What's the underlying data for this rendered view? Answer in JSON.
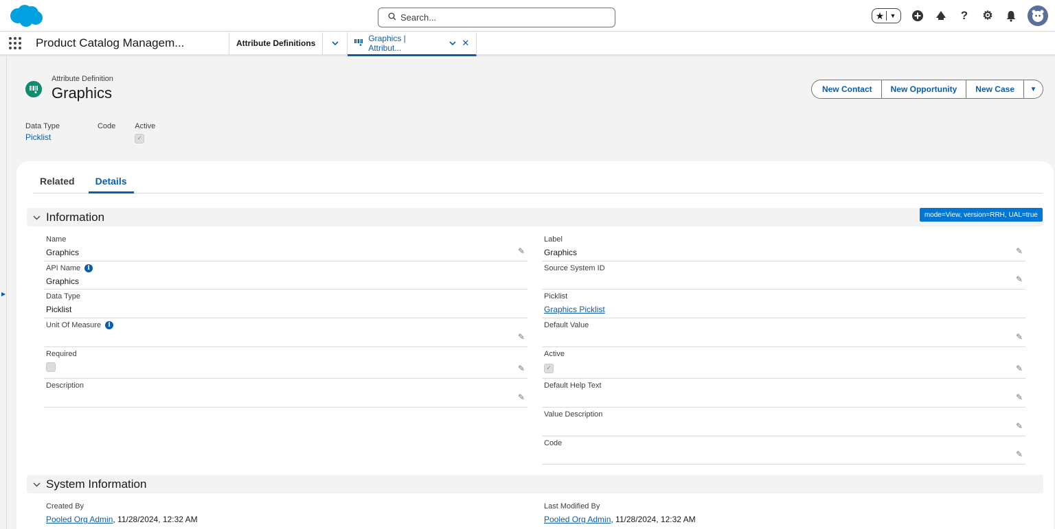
{
  "header": {
    "search_placeholder": "Search...",
    "icons": [
      "favorites-star-icon",
      "favorites-dropdown-icon",
      "add-icon",
      "trailhead-icon",
      "help-icon",
      "settings-gear-icon",
      "notifications-bell-icon",
      "user-avatar"
    ]
  },
  "nav": {
    "app_name": "Product Catalog Managem...",
    "tabs": [
      {
        "label": "Attribute Definitions"
      },
      {
        "label": "Graphics | Attribut..."
      }
    ]
  },
  "record": {
    "object_type": "Attribute Definition",
    "title": "Graphics",
    "actions": [
      "New Contact",
      "New Opportunity",
      "New Case"
    ],
    "highlights": {
      "data_type_label": "Data Type",
      "data_type_value": "Picklist",
      "code_label": "Code",
      "code_value": "",
      "active_label": "Active",
      "active_checked": true
    }
  },
  "tabs": {
    "related": "Related",
    "details": "Details"
  },
  "information": {
    "title": "Information",
    "mode_badge": "mode=View, version=RRH, UAL=true",
    "left": [
      {
        "label": "Name",
        "value": "Graphics"
      },
      {
        "label": "API Name",
        "value": "Graphics"
      },
      {
        "label": "Data Type",
        "value": "Picklist"
      },
      {
        "label": "Unit Of Measure",
        "value": ""
      },
      {
        "label": "Required",
        "value": ""
      },
      {
        "label": "Description",
        "value": ""
      }
    ],
    "right": [
      {
        "label": "Label",
        "value": "Graphics"
      },
      {
        "label": "Source System ID",
        "value": ""
      },
      {
        "label": "Picklist",
        "value": "Graphics Picklist"
      },
      {
        "label": "Default Value",
        "value": ""
      },
      {
        "label": "Active",
        "value": ""
      },
      {
        "label": "Default Help Text",
        "value": ""
      },
      {
        "label": "Value Description",
        "value": ""
      },
      {
        "label": "Code",
        "value": ""
      }
    ]
  },
  "system_information": {
    "title": "System Information",
    "created_by_label": "Created By",
    "created_by_user": "Pooled Org Admin",
    "created_by_date": ", 11/28/2024, 12:32 AM",
    "modified_by_label": "Last Modified By",
    "modified_by_user": "Pooled Org Admin",
    "modified_by_date": ", 11/28/2024, 12:32 AM"
  },
  "colors": {
    "brand_blue": "#0b5cab",
    "salesforce_cloud": "#00a1e0",
    "record_icon": "#0e8a6e",
    "mode_badge_bg": "#0176d3"
  }
}
